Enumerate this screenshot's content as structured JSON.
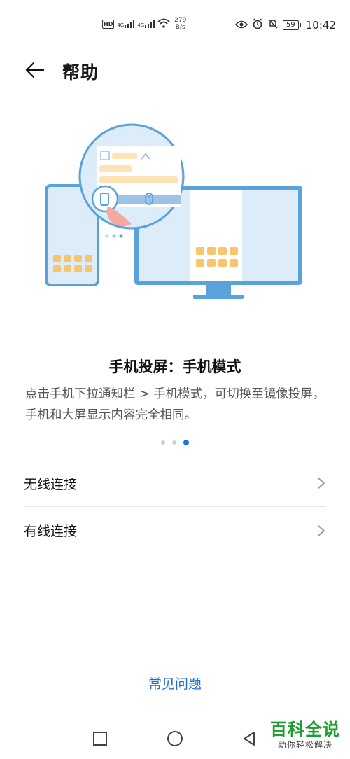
{
  "status_bar": {
    "hd": "HD",
    "signal_1": "4G",
    "signal_2": "4G",
    "speed_value": "279",
    "speed_unit": "B/s",
    "battery": "59",
    "time": "10:42",
    "icons": [
      "hd-icon",
      "signal-icon",
      "signal-icon",
      "wifi-icon",
      "eye-icon",
      "alarm-icon",
      "mute-icon",
      "battery-icon"
    ]
  },
  "header": {
    "title": "帮助",
    "back_icon": "arrow-left-icon"
  },
  "card": {
    "title": "手机投屏：手机模式",
    "description": "点击手机下拉通知栏 > 手机模式，可切换至镜像投屏，手机和大屏显示内容完全相同。",
    "page_count": 3,
    "active_page": 3
  },
  "list": {
    "items": [
      {
        "label": "无线连接"
      },
      {
        "label": "有线连接"
      }
    ]
  },
  "faq": {
    "label": "常见问题"
  },
  "watermark": {
    "main": "百科全说",
    "sub": "助你轻松解决"
  },
  "colors": {
    "accent": "#1f6fd1",
    "illustration_blue": "#5aa2db",
    "illustration_light": "#dcecf9",
    "tile": "#f6c66e"
  }
}
